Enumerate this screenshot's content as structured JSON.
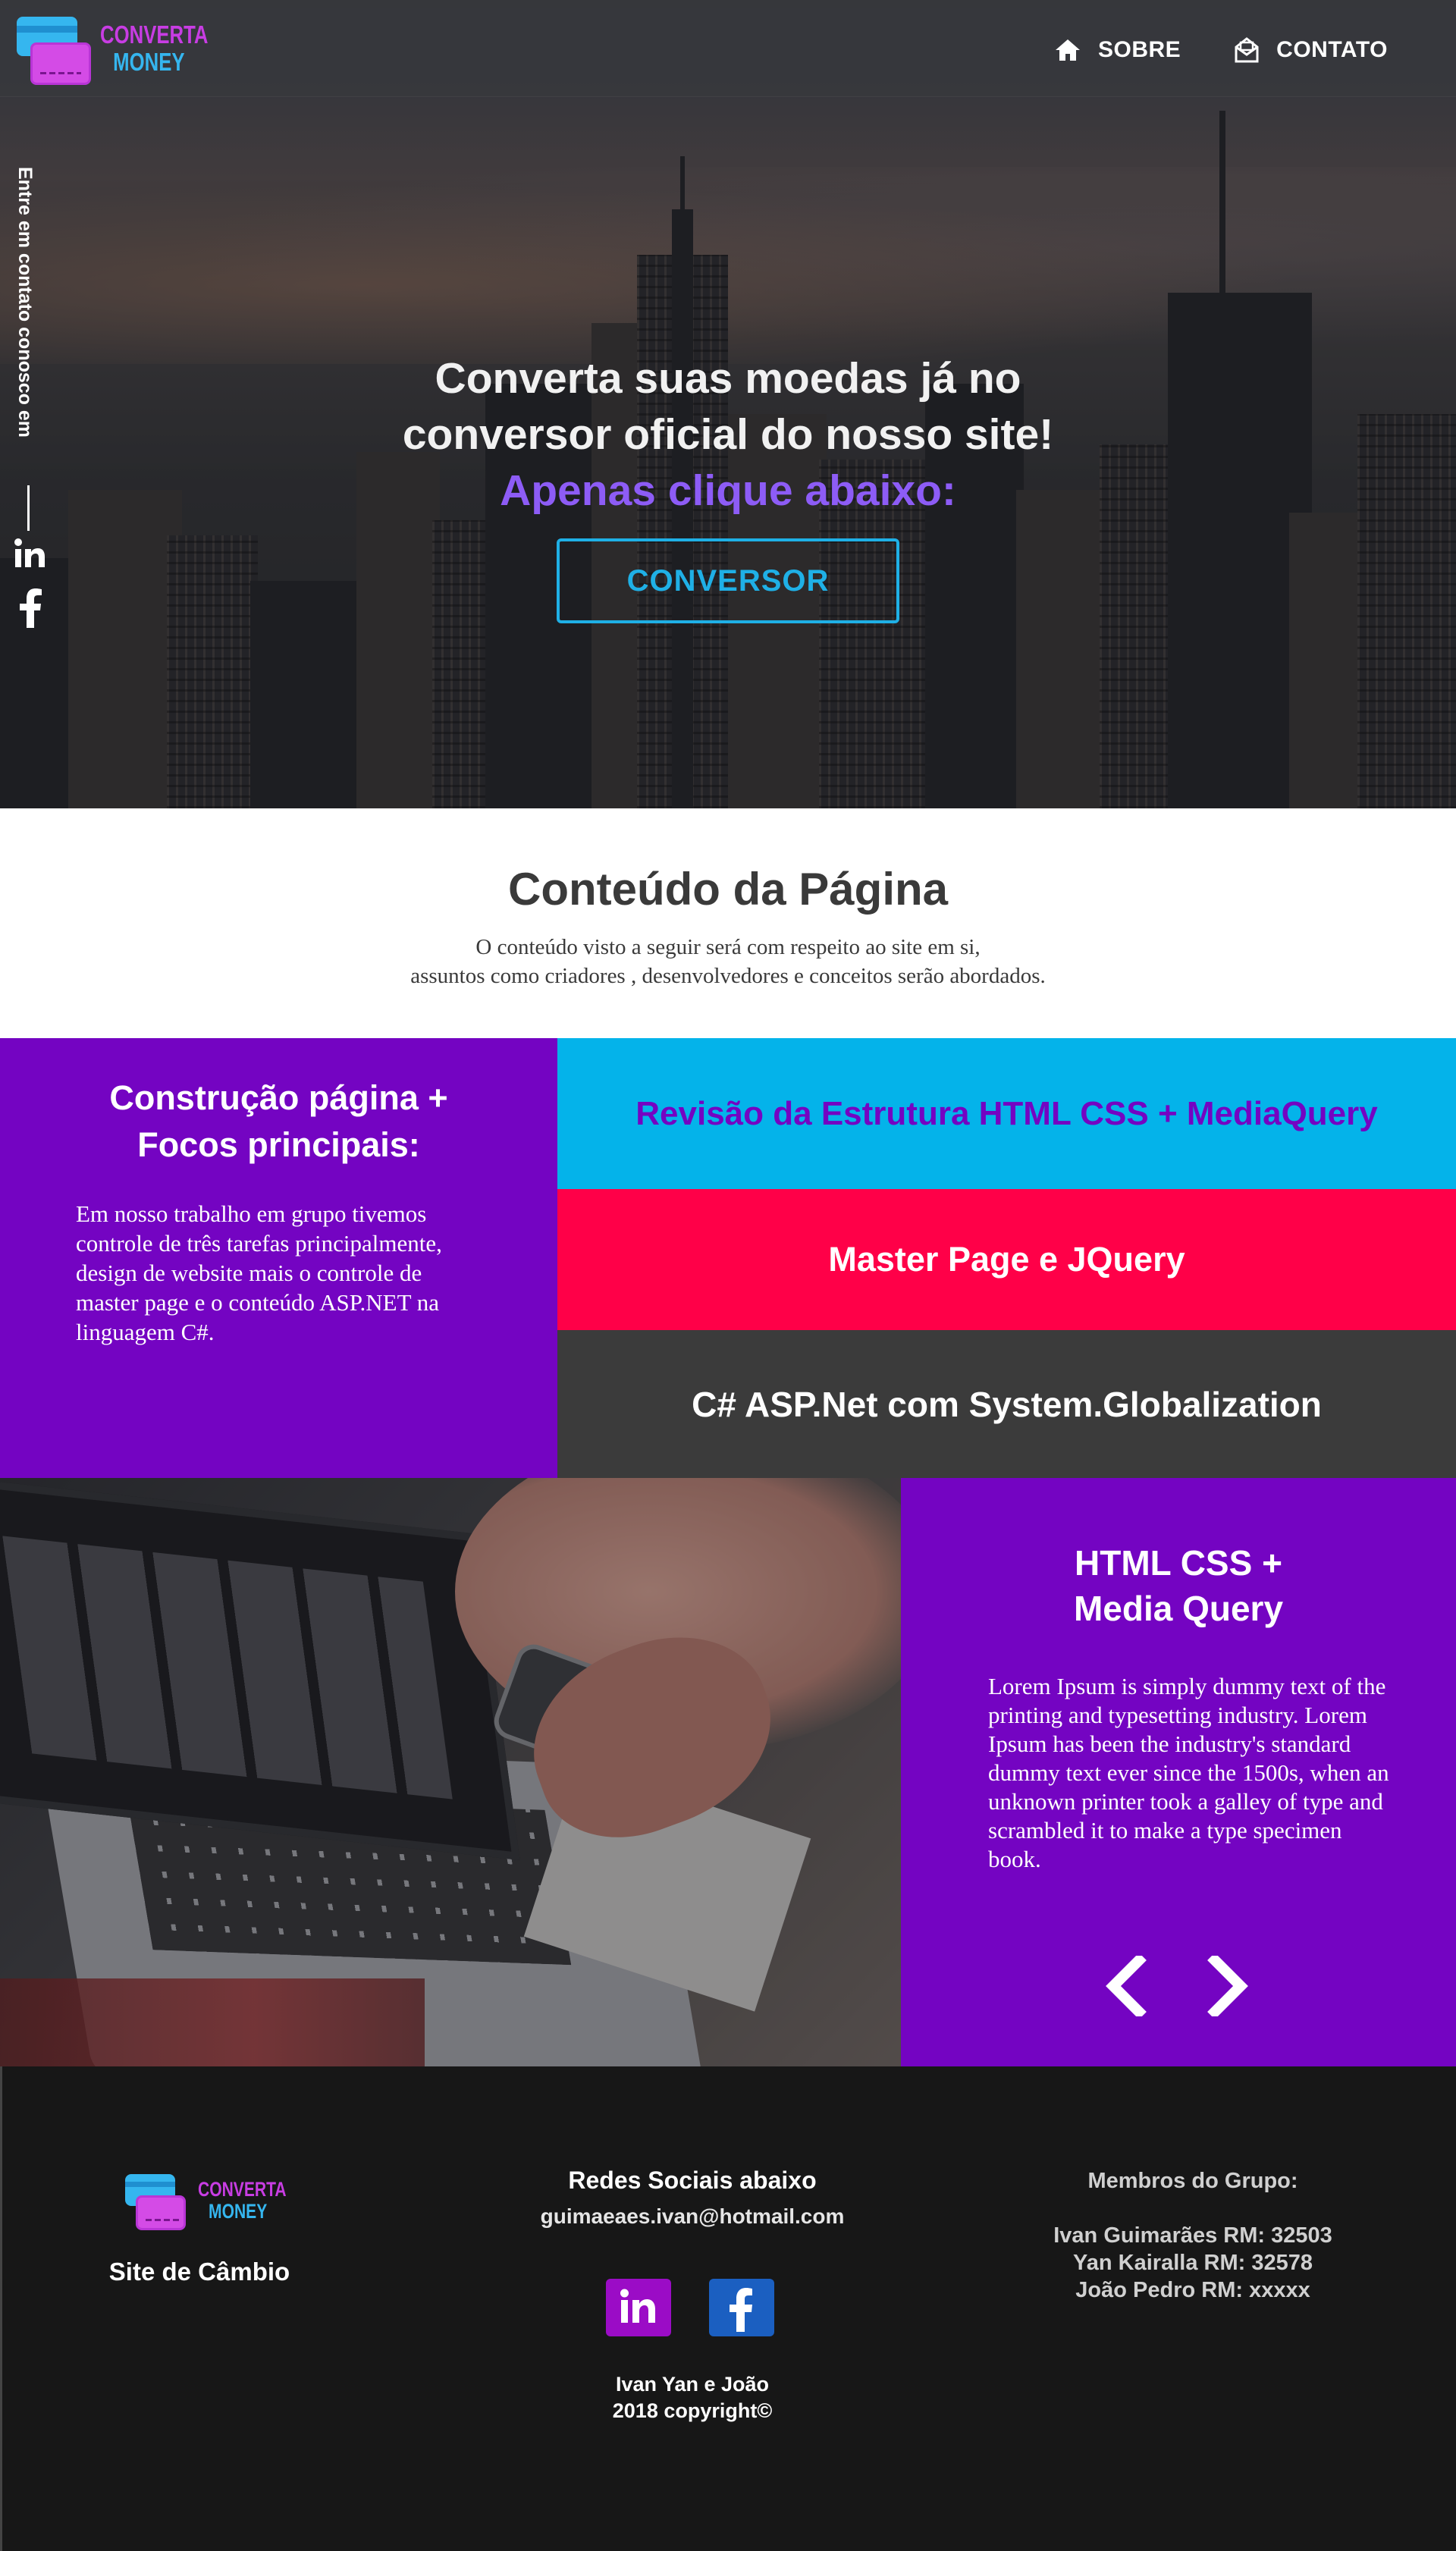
{
  "brand": {
    "name_line1": "CONVERTA",
    "name_line2": "MONEY"
  },
  "nav": {
    "items": [
      {
        "label": "SOBRE",
        "icon": "home-icon"
      },
      {
        "label": "CONTATO",
        "icon": "contact-mail-icon"
      }
    ]
  },
  "side": {
    "contact_text": "Entre em contato conosco em",
    "icons": [
      "linkedin-icon",
      "facebook-icon"
    ]
  },
  "hero": {
    "line1": "Converta suas moedas já no",
    "line2": "conversor oficial do nosso site!",
    "accent": "Apenas clique abaixo:",
    "cta": "CONVERSOR"
  },
  "intro": {
    "title": "Conteúdo da Página",
    "text_line1": "O conteúdo visto a seguir será com respeito ao site em si,",
    "text_line2": "assuntos como criadores , desenvolvedores e conceitos serão abordados."
  },
  "features": {
    "left_title_line1": "Construção página +",
    "left_title_line2": "Focos principais:",
    "left_text": "Em nosso trabalho em grupo tivemos controle de três tarefas principalmente, design de website mais o controle de master page e o conteúdo ASP.NET na linguagem C#.",
    "rows": [
      {
        "label": "Revisão da Estrutura HTML CSS + MediaQuery"
      },
      {
        "label": "Master Page e JQuery"
      },
      {
        "label": "C# ASP.Net com System.Globalization"
      }
    ]
  },
  "slider": {
    "title_line1": "HTML CSS +",
    "title_line2": "Media Query",
    "text": "Lorem Ipsum is simply dummy text of the printing and typesetting industry. Lorem Ipsum has been the industry's standard dummy text ever since the 1500s, when an unknown printer took a galley of type and scrambled it to make a type specimen book."
  },
  "footer": {
    "site_label": "Site de Câmbio",
    "social_title": "Redes Sociais abaixo",
    "email": "guimaeaes.ivan@hotmail.com",
    "credits_line1": "Ivan Yan e João",
    "credits_line2": "2018 copyright©",
    "members_title": "Membros do Grupo:",
    "members": [
      "Ivan Guimarães RM: 32503",
      "Yan Kairalla RM: 32578",
      "João Pedro RM: xxxxx"
    ]
  },
  "colors": {
    "purple": "#7404c2",
    "cyan": "#04b3ea",
    "pink": "#ff0048",
    "dark": "#3b3b3b",
    "footer_bg": "#171717",
    "accent_violet": "#8d5cf6"
  }
}
